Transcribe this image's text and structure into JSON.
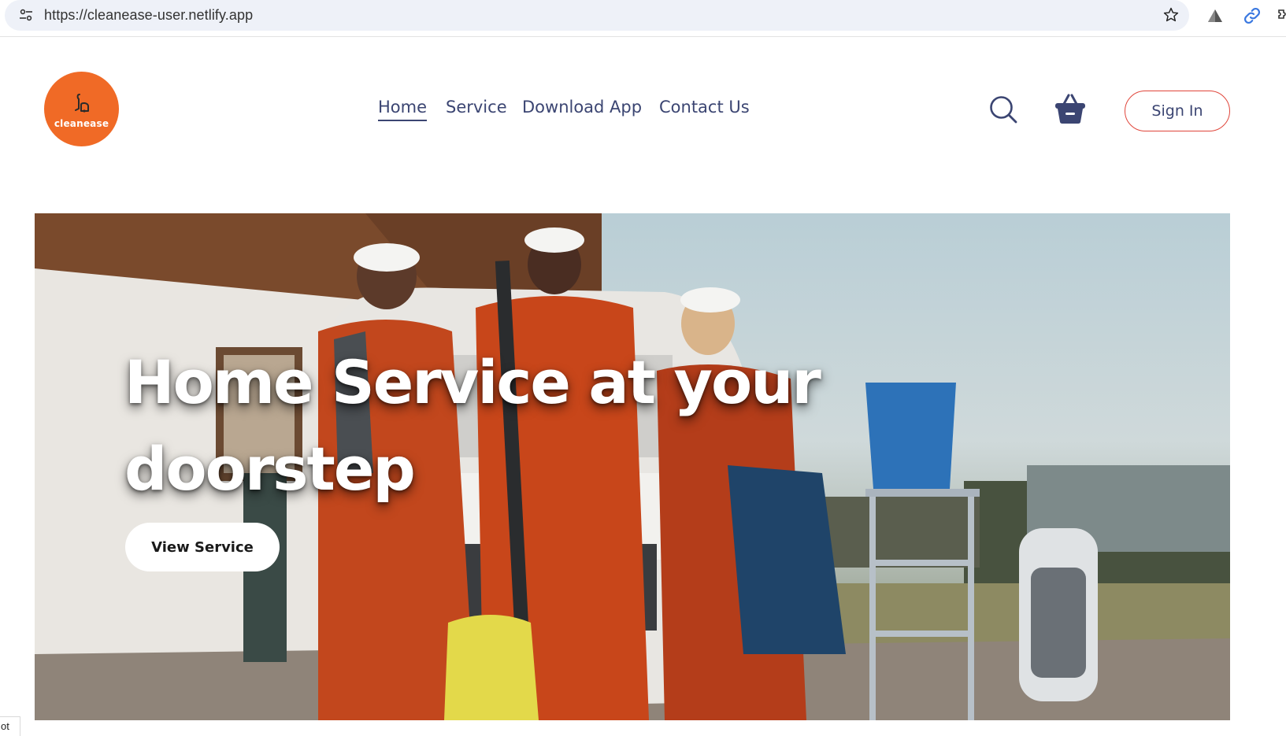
{
  "browser": {
    "url": "https://cleanease-user.netlify.app",
    "site_info_icon": "tune-icon",
    "bookmark_icon": "star-icon",
    "extension_icons": [
      "triangle-icon",
      "link-icon",
      "puzzle-icon"
    ]
  },
  "header": {
    "logo_text": "cleanease",
    "logo_icon": "vacuum-icon",
    "nav": [
      {
        "label": "Home",
        "active": true
      },
      {
        "label": "Service",
        "active": false
      },
      {
        "label": "Download App",
        "active": false
      },
      {
        "label": "Contact Us",
        "active": false
      }
    ],
    "search_icon": "search-icon",
    "cart_icon": "basket-icon",
    "signin_label": "Sign In"
  },
  "hero": {
    "title": "Home Service at your doorstep",
    "cta_label": "View Service"
  },
  "status_fragment": "ot",
  "colors": {
    "brand_orange": "#f06a26",
    "nav_text": "#3b4572",
    "signin_border": "#e0453a"
  }
}
